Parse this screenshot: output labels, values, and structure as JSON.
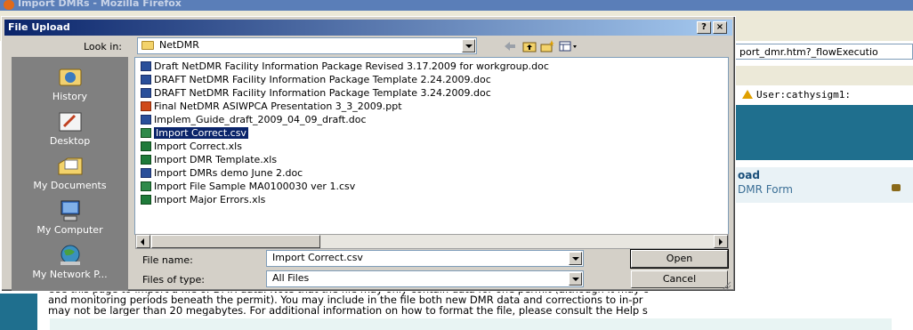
{
  "browser": {
    "window_title": "Import DMRs - Mozilla Firefox",
    "url_fragment": "port_dmr.htm?_flowExecutio",
    "user_label": "User:cathysigm1:",
    "upload_heading": "oad",
    "upload_sub": "DMR Form",
    "body_lines": [
      "Use this page to import a file of DMR data. Note that the file may only contain data for one permit (although it may c",
      "and monitoring periods beneath the permit). You may include in the file both new DMR data and corrections to in-pr",
      "may not be larger than 20 megabytes. For additional information on how to format the file, please consult the Help s"
    ]
  },
  "dialog": {
    "title": "File Upload",
    "help_btn": "?",
    "close_btn": "×",
    "look_in_label": "Look in:",
    "look_in_value": "NetDMR",
    "toolbar_icons": [
      "back-arrow-icon",
      "up-folder-icon",
      "new-folder-icon",
      "view-menu-icon"
    ],
    "places": [
      {
        "label": "History",
        "icon": "history-icon"
      },
      {
        "label": "Desktop",
        "icon": "desktop-icon"
      },
      {
        "label": "My Documents",
        "icon": "my-documents-icon"
      },
      {
        "label": "My Computer",
        "icon": "my-computer-icon"
      },
      {
        "label": "My Network P...",
        "icon": "my-network-icon"
      }
    ],
    "files": [
      {
        "name": "Draft NetDMR Facility Information Package Revised 3.17.2009 for workgroup.doc",
        "type": "doc",
        "selected": false
      },
      {
        "name": "DRAFT NetDMR Facility Information Package Template 2.24.2009.doc",
        "type": "doc",
        "selected": false
      },
      {
        "name": "DRAFT NetDMR Facility Information Package Template 3.24.2009.doc",
        "type": "doc",
        "selected": false
      },
      {
        "name": "Final NetDMR ASIWPCA Presentation 3_3_2009.ppt",
        "type": "ppt",
        "selected": false
      },
      {
        "name": "Implem_Guide_draft_2009_04_09_draft.doc",
        "type": "doc",
        "selected": false
      },
      {
        "name": "Import Correct.csv",
        "type": "csv",
        "selected": true
      },
      {
        "name": "Import Correct.xls",
        "type": "xls",
        "selected": false
      },
      {
        "name": "Import DMR Template.xls",
        "type": "xls",
        "selected": false
      },
      {
        "name": "Import DMRs demo June 2.doc",
        "type": "doc",
        "selected": false
      },
      {
        "name": "Import File Sample MA0100030 ver 1.csv",
        "type": "csv",
        "selected": false
      },
      {
        "name": "Import Major Errors.xls",
        "type": "xls",
        "selected": false
      }
    ],
    "file_name_label": "File name:",
    "file_name_value": "Import Correct.csv",
    "files_of_type_label": "Files of type:",
    "files_of_type_value": "All Files",
    "open_label": "Open",
    "cancel_label": "Cancel"
  }
}
